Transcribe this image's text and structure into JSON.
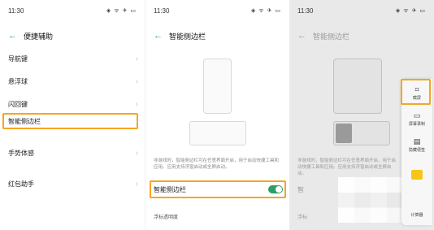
{
  "panel1": {
    "status": {
      "time": "11:30",
      "icons": "◈ ᯤ ✈ ▭"
    },
    "header": {
      "back": "←",
      "title": "便捷辅助"
    },
    "items": [
      {
        "label": "导航键"
      },
      {
        "label": "悬浮球"
      },
      {
        "label": "闪回键"
      },
      {
        "label": "智能侧边栏"
      },
      {
        "label": "手势体感"
      },
      {
        "label": "红包助手"
      }
    ],
    "chevron": "›"
  },
  "panel2": {
    "status": {
      "time": "11:30",
      "icons": "◈ ᯤ ✈ ▭"
    },
    "header": {
      "back": "←",
      "title": "智能侧边栏"
    },
    "description": "非游戏时，智能侧边栏可在任意界面开启，用于启动快捷工具和应用。应用支持浮窗启动或全屏启动。",
    "toggle_label": "智能侧边栏",
    "toggle_on": true,
    "subheading": "浮标透明度"
  },
  "panel3": {
    "status": {
      "time": "11:30",
      "icons": "◈ ᯤ ✈ ▭"
    },
    "header": {
      "back": "←",
      "title": "智能侧边栏"
    },
    "description": "非游戏时，智能侧边栏可在任意界面开启，用于启动快捷工具和应用。应用支持浮窗启动或全屏启动。",
    "row_label_partial": "智",
    "subheading_partial": "浮标",
    "sidebar": [
      {
        "icon": "⌗",
        "label": "截屏",
        "icon_name": "crop-icon"
      },
      {
        "icon": "▭",
        "label": "屏幕录制",
        "icon_name": "screen-record-icon"
      },
      {
        "icon": "▤",
        "label": "隐藏便签",
        "icon_name": "note-icon"
      },
      {
        "icon": "",
        "label": "",
        "icon_name": "folder-icon"
      },
      {
        "icon": "",
        "label": "计算器",
        "icon_name": "calculator-icon"
      }
    ]
  },
  "colors": {
    "accent": "#2e9d68",
    "highlight": "#f5a623"
  }
}
